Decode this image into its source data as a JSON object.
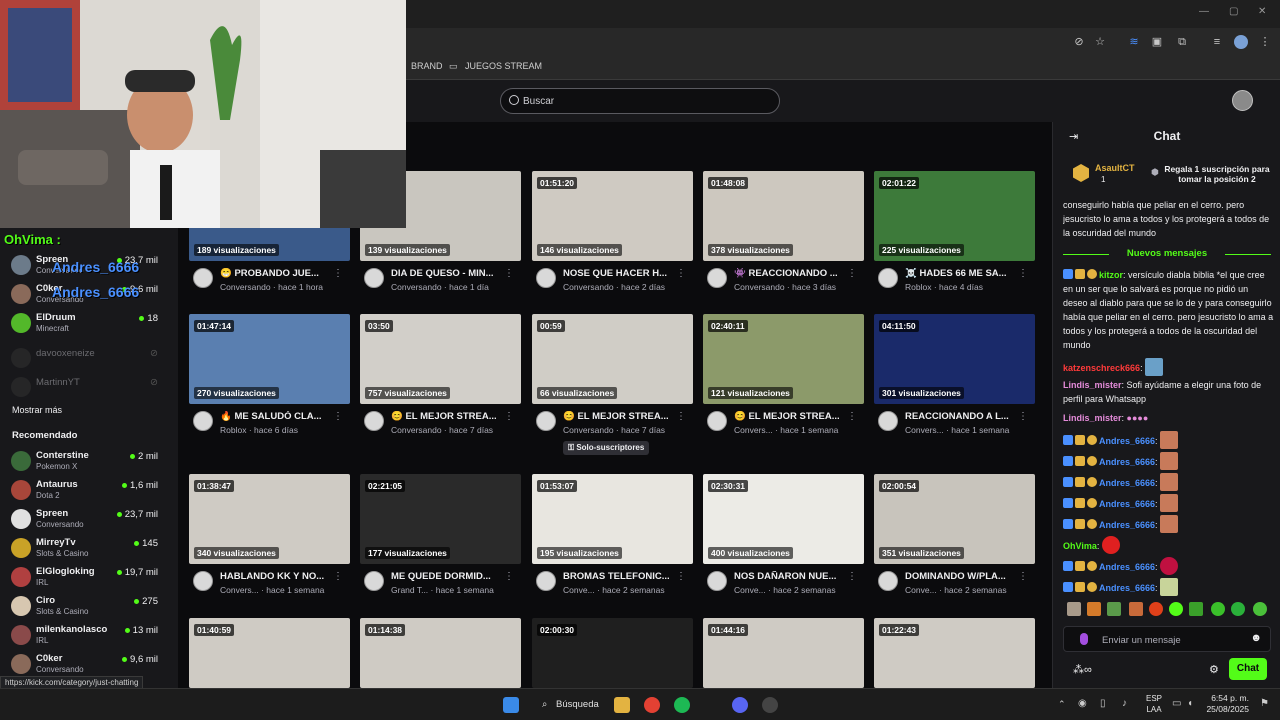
{
  "bookmarks": [
    {
      "label": "BRAND"
    },
    {
      "label": "JUEGOS STREAM"
    }
  ],
  "search": {
    "placeholder": "Buscar"
  },
  "overlay": {
    "chat_user": "OhVima",
    "mention1": "Andres_6666",
    "mention2": "Andres_6666"
  },
  "sidebar": {
    "following": [
      {
        "name": "Spreen",
        "category": "Conversando",
        "viewers": "23,7 mil"
      },
      {
        "name": "C0ker",
        "category": "Conversando",
        "viewers": "9,6 mil"
      },
      {
        "name": "ElDruum",
        "category": "Minecraft",
        "viewers": "18"
      },
      {
        "name": "davooxeneize",
        "category": "",
        "viewers": ""
      },
      {
        "name": "MartinnYT",
        "category": "",
        "viewers": ""
      }
    ],
    "show_more": "Mostrar más",
    "recommended_heading": "Recomendado",
    "recommended": [
      {
        "name": "Conterstine",
        "category": "Pokemon X",
        "viewers": "2 mil"
      },
      {
        "name": "Antaurus",
        "category": "Dota 2",
        "viewers": "1,6 mil"
      },
      {
        "name": "Spreen",
        "category": "Conversando",
        "viewers": "23,7 mil"
      },
      {
        "name": "MirreyTv",
        "category": "Slots & Casino",
        "viewers": "145"
      },
      {
        "name": "ElGlogloking",
        "category": "IRL",
        "viewers": "19,7 mil"
      },
      {
        "name": "Ciro",
        "category": "Slots & Casino",
        "viewers": "275"
      },
      {
        "name": "milenkanolasco",
        "category": "IRL",
        "viewers": "13 mil"
      },
      {
        "name": "C0ker",
        "category": "Conversando",
        "viewers": "9,6 mil"
      }
    ]
  },
  "videos": [
    {
      "duration": "",
      "views": "189 visualizaciones",
      "title": "😁 PROBANDO JUE...",
      "meta": "Conversando · hace 1 hora",
      "thumb": "#3a5a8a"
    },
    {
      "duration": "",
      "views": "139 visualizaciones",
      "title": "DIA DE QUESO - MIN...",
      "meta": "Conversando · hace 1 día",
      "thumb": "#c9c6bf"
    },
    {
      "duration": "01:51:20",
      "views": "146 visualizaciones",
      "title": "NOSE QUE HACER H...",
      "meta": "Conversando · hace 2 días",
      "thumb": "#cfcac2"
    },
    {
      "duration": "01:48:08",
      "views": "378 visualizaciones",
      "title": "👾 REACCIONANDO ...",
      "meta": "Conversando · hace 3 días",
      "thumb": "#cdc8bf"
    },
    {
      "duration": "02:01:22",
      "views": "225 visualizaciones",
      "title": "☠️ HADES 66 ME SA...",
      "meta": "Roblox · hace 4 días",
      "thumb": "#3d7a3a"
    },
    {
      "duration": "01:47:14",
      "views": "270 visualizaciones",
      "title": "🔥 ME SALUDÓ CLA...",
      "meta": "Roblox · hace 6 días",
      "thumb": "#5a7fb0"
    },
    {
      "duration": "03:50",
      "views": "757 visualizaciones",
      "title": "😊 EL MEJOR STREA...",
      "meta": "Conversando · hace 7 días",
      "thumb": "#d2cfc9"
    },
    {
      "duration": "00:59",
      "views": "66 visualizaciones",
      "title": "😊 EL MEJOR STREA...",
      "meta": "Conversando · hace 7 días",
      "thumb": "#d0cdc6",
      "badge": "Solo-suscriptores"
    },
    {
      "duration": "02:40:11",
      "views": "121 visualizaciones",
      "title": "😊 EL MEJOR STREA...",
      "meta": "Convers... · hace 1 semana",
      "thumb": "#8c9a6a"
    },
    {
      "duration": "04:11:50",
      "views": "301 visualizaciones",
      "title": "REACCIONANDO A L...",
      "meta": "Convers... · hace 1 semana",
      "thumb": "#1a2a6a"
    },
    {
      "duration": "01:38:47",
      "views": "340 visualizaciones",
      "title": "HABLANDO KK Y NO...",
      "meta": "Convers... · hace 1 semana",
      "thumb": "#cfcbc4"
    },
    {
      "duration": "02:21:05",
      "views": "177 visualizaciones",
      "title": "ME QUEDE DORMID...",
      "meta": "Grand T... · hace 1 semana",
      "thumb": "#2a2a2a"
    },
    {
      "duration": "01:53:07",
      "views": "195 visualizaciones",
      "title": "BROMAS TELEFONIC...",
      "meta": "Conve... · hace 2 semanas",
      "thumb": "#e8e6e0"
    },
    {
      "duration": "02:30:31",
      "views": "400 visualizaciones",
      "title": "NOS DAÑARON NUE...",
      "meta": "Conve... · hace 2 semanas",
      "thumb": "#ecebe6"
    },
    {
      "duration": "02:00:54",
      "views": "351 visualizaciones",
      "title": "DOMINANDO W/PLA...",
      "meta": "Conve... · hace 2 semanas",
      "thumb": "#c8c4bc"
    },
    {
      "duration": "01:40:59",
      "views": "",
      "title": "",
      "meta": "",
      "thumb": "#cfcbc4"
    },
    {
      "duration": "01:14:38",
      "views": "",
      "title": "",
      "meta": "",
      "thumb": "#cfcbc4"
    },
    {
      "duration": "02:00:30",
      "views": "",
      "title": "",
      "meta": "",
      "thumb": "#1f1f1f"
    },
    {
      "duration": "01:44:16",
      "views": "",
      "title": "",
      "meta": "",
      "thumb": "#cfcbc4"
    },
    {
      "duration": "01:22:43",
      "views": "",
      "title": "",
      "meta": "",
      "thumb": "#cfcbc4"
    }
  ],
  "chat": {
    "title": "Chat",
    "gift_user": "AsaultCT",
    "gift_count": "1",
    "gift_cta": "Regala 1 suscripción para tomar la posición 2",
    "top_message": "conseguirlo había que peliar en el cerro. pero jesucristo lo ama a todos y los protegerá a todos de la oscuridad del mundo",
    "new_messages": "Nuevos mensajes",
    "messages": [
      {
        "user": "kitzor",
        "color": "#53fc18",
        "text": "versículo diabla biblia *el que cree en un ser que lo salvará es porque no pidió un deseo al diablo para que se lo de y para conseguirlo había que peliar en el cerro. pero jesucristo lo ama a todos y los protegerá a todos de la oscuridad del mundo"
      },
      {
        "user": "katzenschreck666",
        "color": "#ff3a3a",
        "text": ""
      },
      {
        "user": "Lindis_mister",
        "color": "#e48bd9",
        "text": "Sofi ayúdame a elegir una foto de perfil para Whatsapp"
      },
      {
        "user": "Lindis_mister",
        "color": "#e48bd9",
        "text": ""
      },
      {
        "user": "Andres_6666",
        "color": "#4a90ff",
        "text": ""
      },
      {
        "user": "Andres_6666",
        "color": "#4a90ff",
        "text": ""
      },
      {
        "user": "Andres_6666",
        "color": "#4a90ff",
        "text": ""
      },
      {
        "user": "Andres_6666",
        "color": "#4a90ff",
        "text": ""
      },
      {
        "user": "Andres_6666",
        "color": "#4a90ff",
        "text": ""
      },
      {
        "user": "OhVima",
        "color": "#53fc18",
        "text": ""
      },
      {
        "user": "Andres_6666",
        "color": "#4a90ff",
        "text": ""
      },
      {
        "user": "Andres_6666",
        "color": "#4a90ff",
        "text": ""
      }
    ],
    "input_placeholder": "Enviar un mensaje",
    "send_label": "Chat"
  },
  "status_url": "https://kick.com/category/just-chatting",
  "taskbar": {
    "search": "Búsqueda",
    "lang1": "ESP",
    "lang2": "LAA",
    "time": "6:54 p. m.",
    "date": "25/08/2025"
  }
}
